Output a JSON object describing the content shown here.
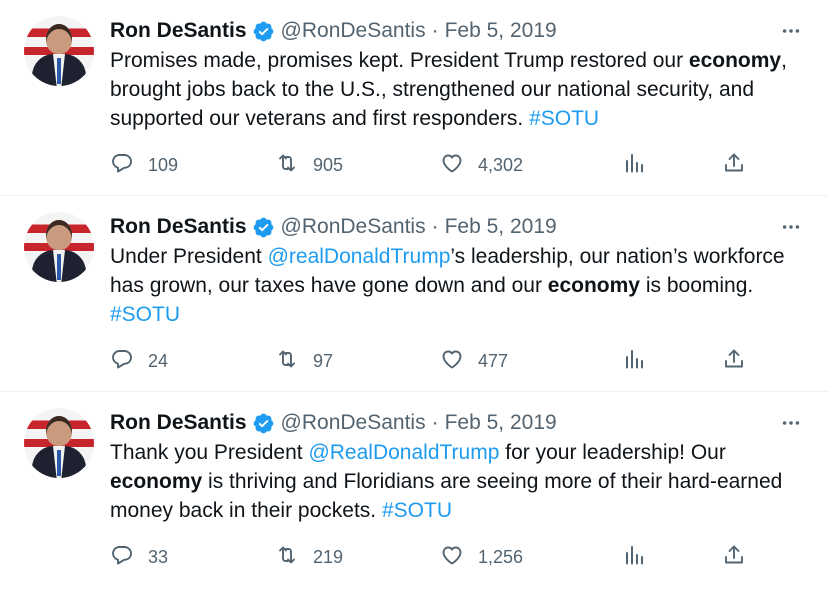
{
  "tweets": [
    {
      "author": "Ron DeSantis",
      "handle": "@RonDeSantis",
      "separator": "·",
      "date": "Feb 5, 2019",
      "text_parts": [
        {
          "t": "Promises made, promises kept. President Trump restored our ",
          "s": "plain"
        },
        {
          "t": "economy",
          "s": "bold"
        },
        {
          "t": ", brought jobs back to the U.S., strengthened our national security, and supported our veterans and first responders. ",
          "s": "plain"
        },
        {
          "t": "#SOTU",
          "s": "link"
        }
      ],
      "replies": "109",
      "retweets": "905",
      "likes": "4,302"
    },
    {
      "author": "Ron DeSantis",
      "handle": "@RonDeSantis",
      "separator": "·",
      "date": "Feb 5, 2019",
      "text_parts": [
        {
          "t": "Under President ",
          "s": "plain"
        },
        {
          "t": "@realDonaldTrump",
          "s": "link"
        },
        {
          "t": "’s leadership, our nation’s workforce has grown, our taxes have gone down and our ",
          "s": "plain"
        },
        {
          "t": "economy",
          "s": "bold"
        },
        {
          "t": " is booming. ",
          "s": "plain"
        },
        {
          "t": "#SOTU",
          "s": "link"
        }
      ],
      "replies": "24",
      "retweets": "97",
      "likes": "477"
    },
    {
      "author": "Ron DeSantis",
      "handle": "@RonDeSantis",
      "separator": "·",
      "date": "Feb 5, 2019",
      "text_parts": [
        {
          "t": "Thank you President ",
          "s": "plain"
        },
        {
          "t": "@RealDonaldTrump",
          "s": "link"
        },
        {
          "t": " for your leadership! Our ",
          "s": "plain"
        },
        {
          "t": "economy",
          "s": "bold"
        },
        {
          "t": " is thriving and Floridians are seeing more of their hard-earned money back in their pockets. ",
          "s": "plain"
        },
        {
          "t": "#SOTU",
          "s": "link"
        }
      ],
      "replies": "33",
      "retweets": "219",
      "likes": "1,256"
    }
  ],
  "colors": {
    "text": "#0f1419",
    "secondary": "#536471",
    "link": "#1d9bf0",
    "verified": "#1d9bf0"
  },
  "icons": [
    "verified-badge-icon",
    "more-icon",
    "reply-icon",
    "retweet-icon",
    "like-icon",
    "views-icon",
    "share-icon"
  ]
}
